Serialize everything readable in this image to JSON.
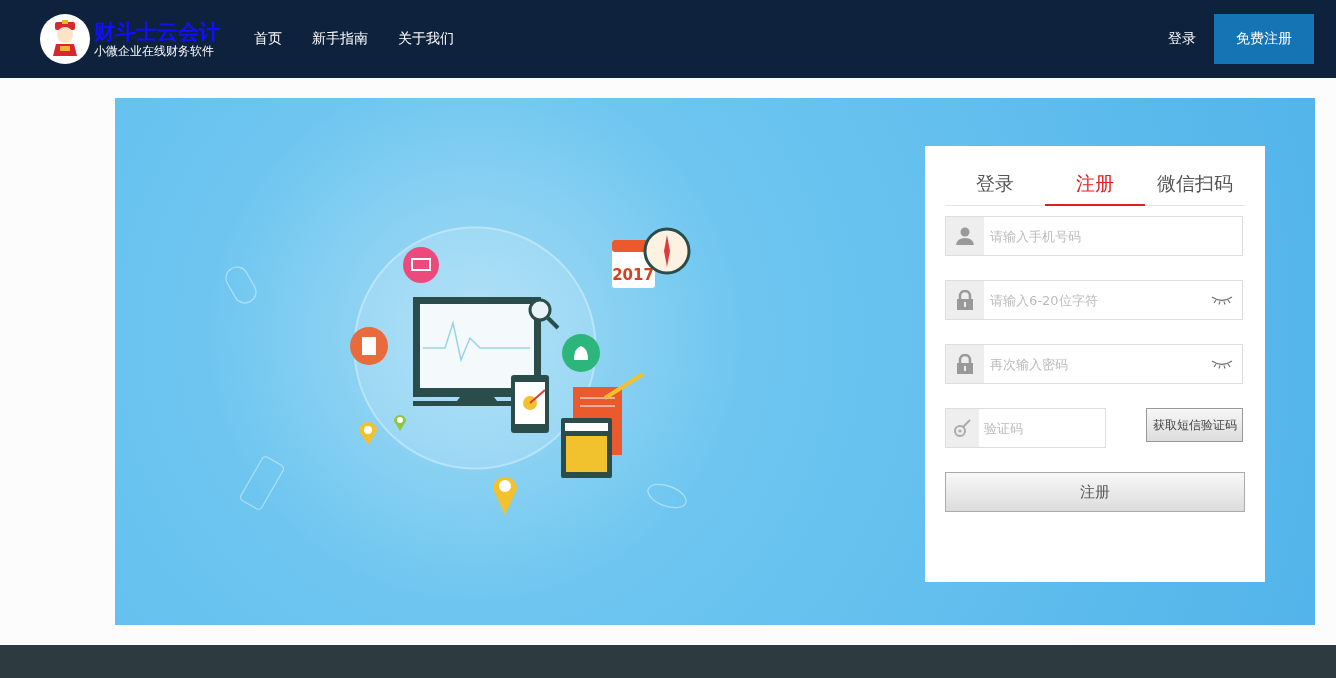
{
  "header": {
    "logo_title": "财斗士云会计",
    "logo_subtitle": "小微企业在线财务软件",
    "nav": [
      "首页",
      "新手指南",
      "关于我们"
    ],
    "login_link": "登录",
    "register_button": "免费注册"
  },
  "banner": {
    "calendar_year": "2017"
  },
  "form": {
    "tabs": [
      {
        "label": "登录",
        "selected": false
      },
      {
        "label": "注册",
        "selected": true
      },
      {
        "label": "微信扫码",
        "selected": false
      }
    ],
    "fields": [
      {
        "kind": "phone",
        "placeholder": "请输入手机号码"
      },
      {
        "kind": "password",
        "placeholder": "请输入6-20位字符"
      },
      {
        "kind": "password",
        "placeholder": "再次输入密码"
      },
      {
        "kind": "code",
        "placeholder": "验证码"
      }
    ],
    "sms_button": "获取短信验证码",
    "submit_button": "注册"
  }
}
